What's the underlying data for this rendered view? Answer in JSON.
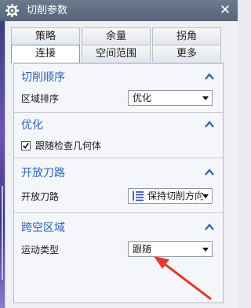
{
  "window": {
    "title": "切削参数",
    "close_label": "✕"
  },
  "tabs": {
    "row1": [
      "策略",
      "余量",
      "拐角"
    ],
    "row2": [
      "连接",
      "空间范围",
      "更多"
    ],
    "active": "连接"
  },
  "groups": {
    "cut_order": {
      "title": "切削顺序",
      "region_order_label": "区域排序",
      "region_order_value": "优化"
    },
    "optimize": {
      "title": "优化",
      "follow_check_label": "跟随检查几何体",
      "follow_check_checked": true
    },
    "open_tool_path": {
      "title": "开放刀路",
      "label": "开放刀路",
      "value": "保持切削方向"
    },
    "span_region": {
      "title": "跨空区域",
      "motion_type_label": "运动类型",
      "motion_type_value": "跟随"
    }
  },
  "colors": {
    "titlebar": "#5f6e82",
    "group_title": "#2a64b8",
    "annotation_arrow": "#e03a2f"
  }
}
